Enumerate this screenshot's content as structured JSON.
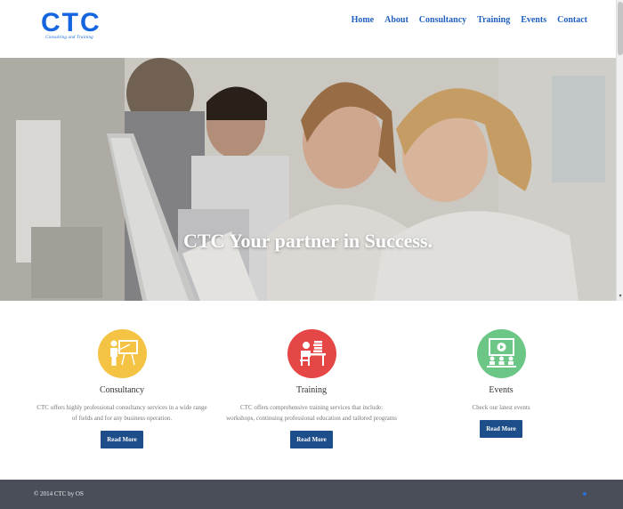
{
  "brand": {
    "logo_text": "CTC",
    "tagline": "Consulting and Training",
    "color": "#1565e0"
  },
  "nav": {
    "items": [
      "Home",
      "About",
      "Consultancy",
      "Training",
      "Events",
      "Contact"
    ]
  },
  "hero": {
    "title": "CTC Your partner in Success."
  },
  "features": [
    {
      "name": "Consultancy",
      "icon": "presenter-board-icon",
      "color": "#f4c343",
      "desc1": "CTC offers highly professional consultancy services in a wide range",
      "desc2": "of fields and for any business operation.",
      "button": "Read More"
    },
    {
      "name": "Training",
      "icon": "student-desk-icon",
      "color": "#e54646",
      "desc1": "CTC offers comprehensive training services that include:",
      "desc2": "workshops, continuing professional education and tailored programs",
      "button": "Read More"
    },
    {
      "name": "Events",
      "icon": "video-audience-icon",
      "color": "#6cc685",
      "desc1": "Check our latest events",
      "desc2": "",
      "button": "Read More"
    }
  ],
  "footer": {
    "copyright": "© 2014 CTC by OS"
  }
}
